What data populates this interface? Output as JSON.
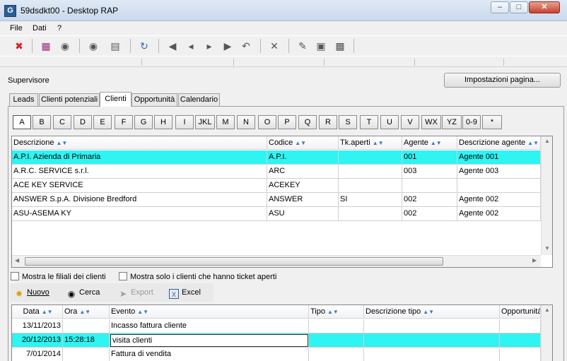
{
  "window": {
    "title": "59dsdkt00 - Desktop RAP",
    "icon": "G"
  },
  "menu": [
    "File",
    "Dati",
    "?"
  ],
  "toolbar_icons": [
    "close-app-icon",
    "book-icon",
    "binoculars-icon",
    "search-binoculars-icon",
    "print-preview-icon",
    "refresh-icon",
    "first-record-icon",
    "previous-record-icon",
    "next-record-icon",
    "last-record-icon",
    "undo-icon",
    "delete-icon",
    "edit-icon",
    "folder-icon",
    "network-icon"
  ],
  "supervisor_label": "Supervisore",
  "page_settings_button": "Impostazioni pagina...",
  "tabs": [
    "Leads",
    "Clienti potenziali",
    "Clienti",
    "Opportunità",
    "Calendario"
  ],
  "active_tab": "Clienti",
  "letters": [
    "A",
    "B",
    "C",
    "D",
    "E",
    "F",
    "G",
    "H",
    "I",
    "JKL",
    "M",
    "N",
    "O",
    "P",
    "Q",
    "R",
    "S",
    "T",
    "U",
    "V",
    "WX",
    "YZ",
    "0-9",
    "*"
  ],
  "active_letter": "A",
  "clients": {
    "columns": [
      "Descrizione",
      "Codice",
      "Tk.aperti",
      "Agente",
      "Descrizione agente"
    ],
    "rows": [
      [
        "A.P.I. Azienda di Primaria",
        "A.P.I.",
        "",
        "001",
        "Agente 001"
      ],
      [
        "A.R.C. SERVICE s.r.l.",
        "ARC",
        "",
        "003",
        "Agente 003"
      ],
      [
        "ACE KEY SERVICE",
        "ACEKEY",
        "",
        "",
        ""
      ],
      [
        "ANSWER S.p.A. Divisione Bredford",
        "ANSWER",
        "SI",
        "002",
        "Agente 002"
      ],
      [
        "ASU-ASEMA KY",
        "ASU",
        "",
        "002",
        "Agente 002"
      ]
    ],
    "selected_row": 0
  },
  "checkbox_branches": "Mostra le filiali dei clienti",
  "checkbox_open_tickets": "Mostra solo i clienti che hanno ticket aperti",
  "actions": {
    "new": "Nuovo",
    "search": "Cerca",
    "export": "Export",
    "excel": "Excel"
  },
  "events": {
    "columns": [
      "Data",
      "Ora",
      "Evento",
      "Tipo",
      "Descrizione tipo",
      "Opportunità"
    ],
    "rows": [
      [
        "13/11/2013",
        "",
        "Incasso fattura cliente",
        "",
        "",
        ""
      ],
      [
        "20/12/2013",
        "15:28:18",
        "visita clienti",
        "",
        "",
        ""
      ],
      [
        "7/01/2014",
        "",
        "Fattura di vendita",
        "",
        "",
        ""
      ]
    ],
    "selected_row": 1
  },
  "colors": {
    "selection": "#2ef4f2"
  }
}
